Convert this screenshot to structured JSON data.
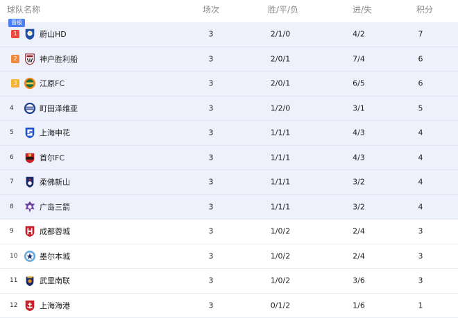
{
  "header": {
    "team": "球队名称",
    "played": "场次",
    "wdl": "胜/平/负",
    "goals": "进/失",
    "points": "积分"
  },
  "promotion_tag": "晋级",
  "colors": {
    "promo_bg": "#eef1fb",
    "tag_blue": "#4a7ef6",
    "rank1": "#f0463c",
    "rank2": "#f0883c",
    "rank3": "#f5b432"
  },
  "rows": [
    {
      "rank": "1",
      "team": "蔚山HD",
      "played": "3",
      "wdl": "2/1/0",
      "goals": "4/2",
      "points": "7",
      "logo": "ulsan-crest-icon"
    },
    {
      "rank": "2",
      "team": "神户胜利船",
      "played": "3",
      "wdl": "2/0/1",
      "goals": "7/4",
      "points": "6",
      "logo": "kobe-crest-icon"
    },
    {
      "rank": "3",
      "team": "江原FC",
      "played": "3",
      "wdl": "2/0/1",
      "goals": "6/5",
      "points": "6",
      "logo": "gangwon-crest-icon"
    },
    {
      "rank": "4",
      "team": "町田泽维亚",
      "played": "3",
      "wdl": "1/2/0",
      "goals": "3/1",
      "points": "5",
      "logo": "machida-crest-icon"
    },
    {
      "rank": "5",
      "team": "上海申花",
      "played": "3",
      "wdl": "1/1/1",
      "goals": "4/3",
      "points": "4",
      "logo": "shenhua-crest-icon"
    },
    {
      "rank": "6",
      "team": "首尔FC",
      "played": "3",
      "wdl": "1/1/1",
      "goals": "4/3",
      "points": "4",
      "logo": "seoul-crest-icon"
    },
    {
      "rank": "7",
      "team": "柔佛新山",
      "played": "3",
      "wdl": "1/1/1",
      "goals": "3/2",
      "points": "4",
      "logo": "johor-crest-icon"
    },
    {
      "rank": "8",
      "team": "广岛三箭",
      "played": "3",
      "wdl": "1/1/1",
      "goals": "3/2",
      "points": "4",
      "logo": "hiroshima-crest-icon"
    },
    {
      "rank": "9",
      "team": "成都蓉城",
      "played": "3",
      "wdl": "1/0/2",
      "goals": "2/4",
      "points": "3",
      "logo": "chengdu-crest-icon"
    },
    {
      "rank": "10",
      "team": "墨尔本城",
      "played": "3",
      "wdl": "1/0/2",
      "goals": "2/4",
      "points": "3",
      "logo": "melbourne-crest-icon"
    },
    {
      "rank": "11",
      "team": "武里南联",
      "played": "3",
      "wdl": "1/0/2",
      "goals": "3/6",
      "points": "3",
      "logo": "buriram-crest-icon"
    },
    {
      "rank": "12",
      "team": "上海海港",
      "played": "3",
      "wdl": "0/1/2",
      "goals": "1/6",
      "points": "1",
      "logo": "port-crest-icon"
    }
  ]
}
